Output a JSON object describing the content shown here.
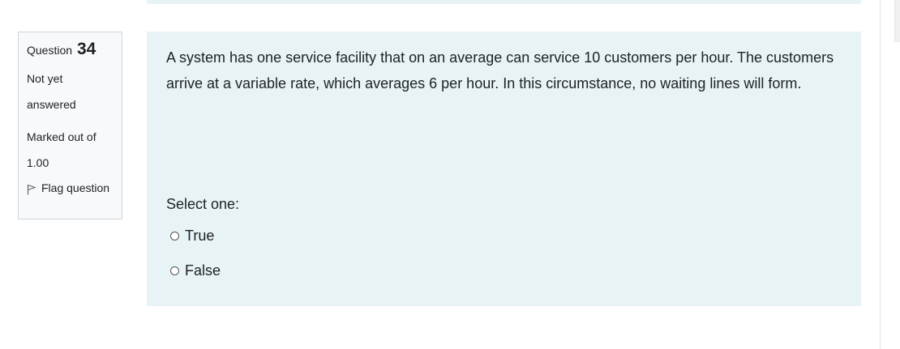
{
  "question": {
    "label": "Question",
    "number": "34",
    "state_line1": "Not yet",
    "state_line2": "answered",
    "grade_line1": "Marked out of",
    "grade_line2": "1.00",
    "flag_label": "Flag question",
    "flag_icon": "flag-icon"
  },
  "content": {
    "text": "A system has one service facility that on an average can service 10 customers per hour. The customers arrive at a variable rate, which averages 6 per hour. In this circumstance, no waiting lines will form.",
    "prompt": "Select one:",
    "options": [
      {
        "label": "True"
      },
      {
        "label": "False"
      }
    ]
  },
  "colors": {
    "content_bg": "#e7f3f5",
    "info_bg": "#f8f9fa",
    "info_border": "#cfd4d9",
    "text": "#1d2125"
  }
}
